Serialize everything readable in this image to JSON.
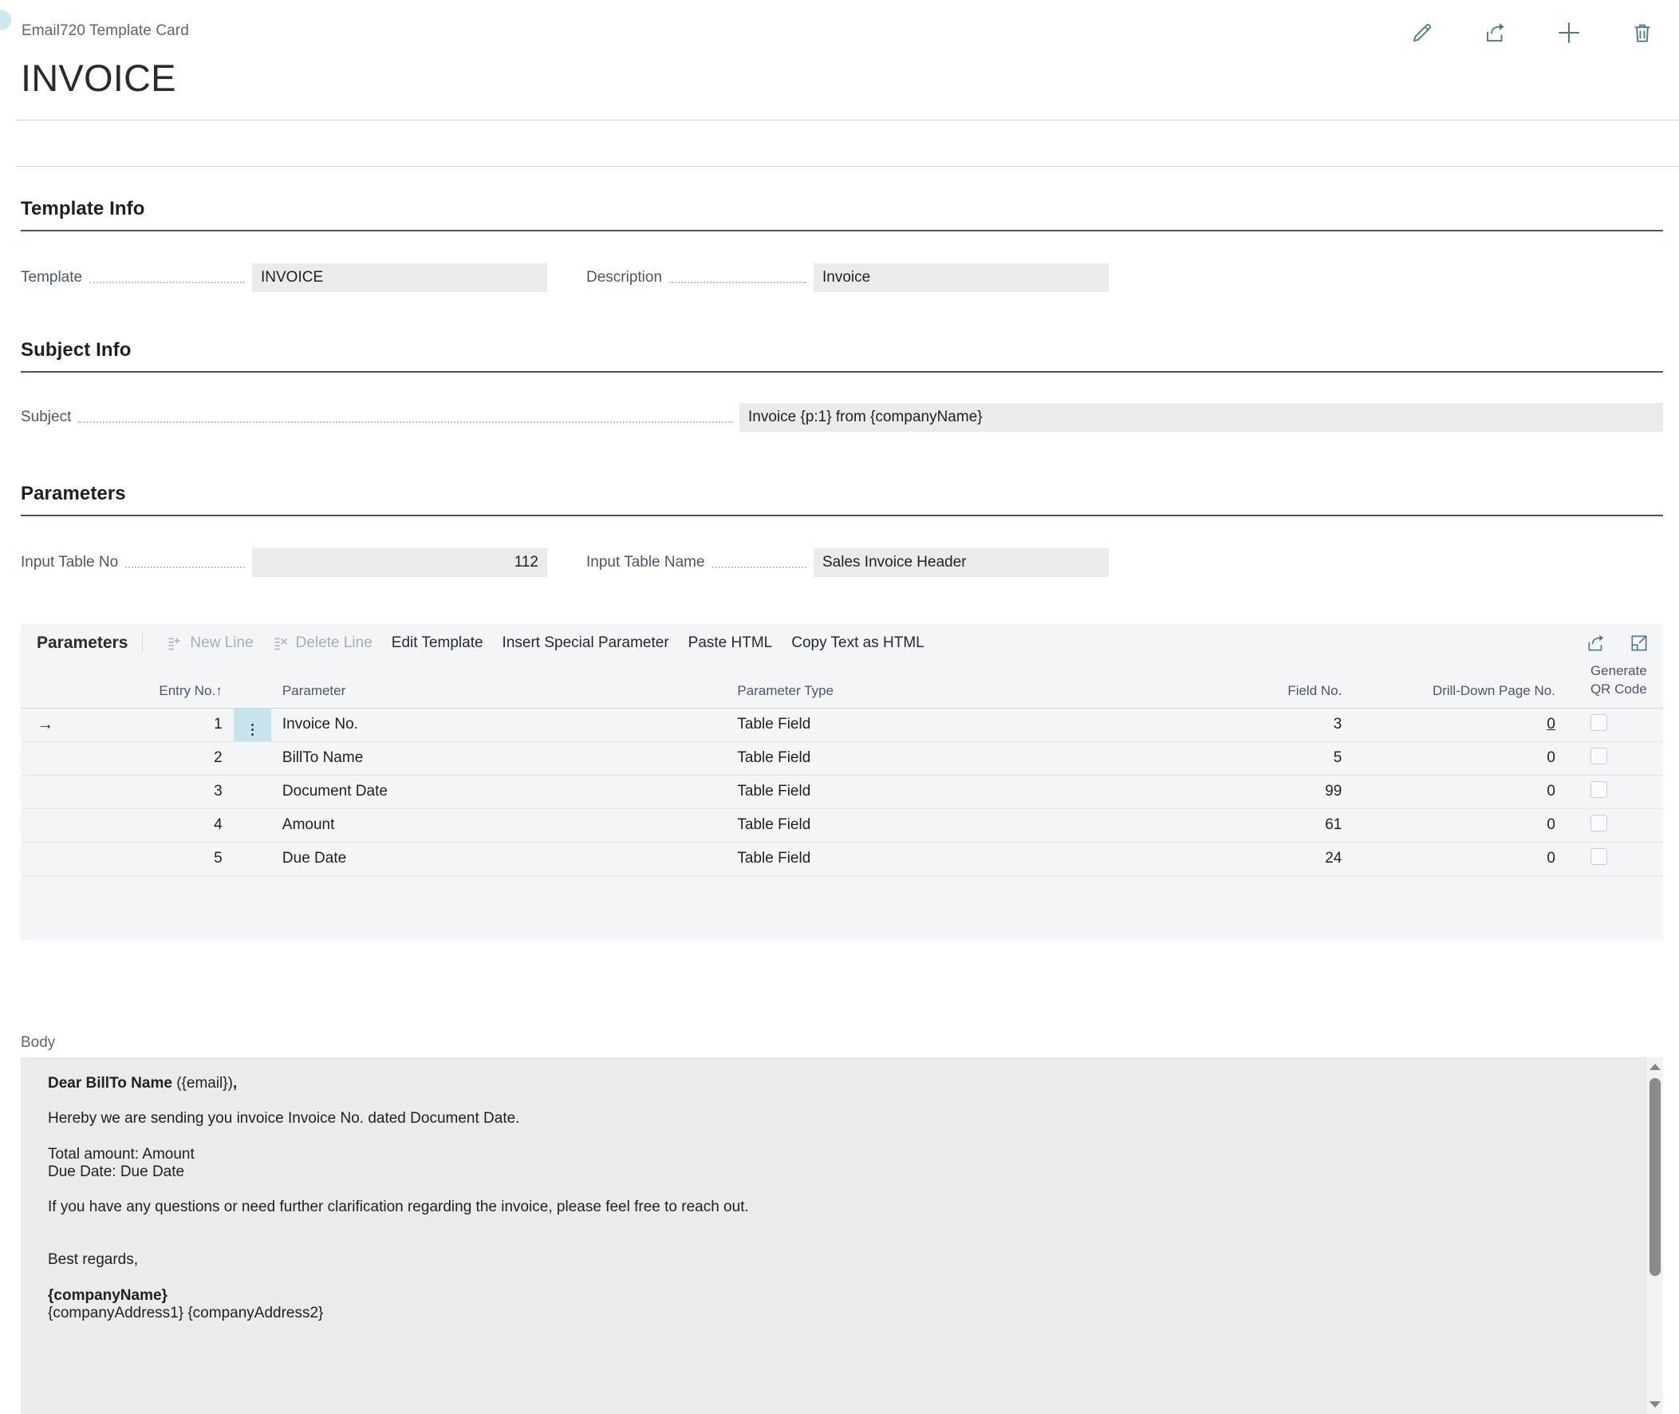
{
  "header": {
    "breadcrumb": "Email720 Template Card",
    "title": "INVOICE",
    "actions": [
      {
        "name": "edit-icon",
        "label": "Edit"
      },
      {
        "name": "share-icon",
        "label": "Share"
      },
      {
        "name": "plus-icon",
        "label": "New"
      },
      {
        "name": "trash-icon",
        "label": "Delete"
      }
    ]
  },
  "template_info": {
    "heading": "Template Info",
    "template_label": "Template",
    "template_value": "INVOICE",
    "description_label": "Description",
    "description_value": "Invoice"
  },
  "subject_info": {
    "heading": "Subject Info",
    "subject_label": "Subject",
    "subject_value": "Invoice {p:1} from {companyName}"
  },
  "parameters_section": {
    "heading": "Parameters",
    "input_table_no_label": "Input Table No",
    "input_table_no_value": "112",
    "input_table_name_label": "Input Table Name",
    "input_table_name_value": "Sales Invoice Header"
  },
  "grid": {
    "caption": "Parameters",
    "toolbar": [
      {
        "label": "New Line",
        "disabled": true,
        "icon": "new-line-icon"
      },
      {
        "label": "Delete Line",
        "disabled": true,
        "icon": "delete-line-icon"
      },
      {
        "label": "Edit Template",
        "disabled": false
      },
      {
        "label": "Insert Special Parameter",
        "disabled": false
      },
      {
        "label": "Paste HTML",
        "disabled": false
      },
      {
        "label": "Copy Text as HTML",
        "disabled": false
      }
    ],
    "toolbar_icons": [
      {
        "name": "share-icon"
      },
      {
        "name": "open-in-new-icon"
      }
    ],
    "columns": [
      "Entry No.",
      "Parameter",
      "Parameter Type",
      "Field No.",
      "Drill-Down Page No.",
      "Generate QR Code"
    ],
    "sort_indicator": "↑",
    "rows": [
      {
        "entry_no": "1",
        "parameter": "Invoice No.",
        "parameter_type": "Table Field",
        "field_no": "3",
        "drill_down": "0",
        "qr": false,
        "selected": true
      },
      {
        "entry_no": "2",
        "parameter": "BillTo Name",
        "parameter_type": "Table Field",
        "field_no": "5",
        "drill_down": "0",
        "qr": false,
        "selected": false
      },
      {
        "entry_no": "3",
        "parameter": "Document Date",
        "parameter_type": "Table Field",
        "field_no": "99",
        "drill_down": "0",
        "qr": false,
        "selected": false
      },
      {
        "entry_no": "4",
        "parameter": "Amount",
        "parameter_type": "Table Field",
        "field_no": "61",
        "drill_down": "0",
        "qr": false,
        "selected": false
      },
      {
        "entry_no": "5",
        "parameter": "Due Date",
        "parameter_type": "Table Field",
        "field_no": "24",
        "drill_down": "0",
        "qr": false,
        "selected": false
      }
    ]
  },
  "body": {
    "label": "Body",
    "lines": {
      "greet_bold": "Dear BillTo Name",
      "greet_rest": " ({email})",
      "greet_comma": ",",
      "l1": "Hereby we are sending you invoice Invoice No. dated Document Date.",
      "l2": "Total amount: Amount",
      "l3": "Due Date: Due Date",
      "l4": "If you have any questions or need further clarification regarding the invoice, please feel free to reach out.",
      "l5": "Best regards,",
      "l6": "{companyName}",
      "l7": "{companyAddress1} {companyAddress2}"
    }
  },
  "colors": {
    "accent": "#4a7b86",
    "selection": "#c7e4ec",
    "input_bg": "#ebebeb",
    "grid_bg": "#f4f5f7"
  }
}
